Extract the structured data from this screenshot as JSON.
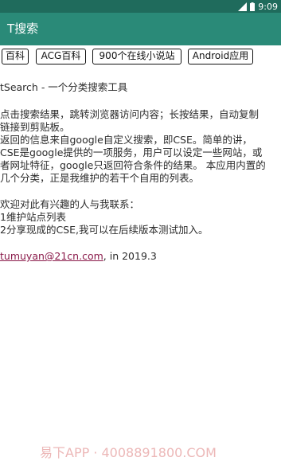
{
  "status_bar": {
    "time": "9:09"
  },
  "app_bar": {
    "title": "T搜索"
  },
  "tabs": [
    "百科",
    "ACG百科",
    "900个在线小说站",
    "Android应用"
  ],
  "content": {
    "app_name_line": "tSearch - 一个分类搜索工具",
    "usage_line_1": "点击搜索结果，跳转浏览器访问内容；长按结果，自动复制",
    "usage_line_2": "链接到剪贴板。",
    "cse_line_1": "返回的信息来自google自定义搜索，即CSE。简单的讲，",
    "cse_line_2": "CSE是google提供的一项服务，用户可以设定一些网站，或",
    "cse_line_3": "者网址特征，google只返回符合条件的结果。 本应用内置的",
    "cse_line_4": "几个分类，正是我维护的若干个自用的列表。",
    "contact_line": "欢迎对此有兴趣的人与我联系：",
    "contact_item_1": "1维护站点列表",
    "contact_item_2": "2分享现成的CSE,我可以在后续版本测试加入。",
    "email": "tumuyan@21cn.com",
    "year_suffix": ", in 2019.3"
  },
  "watermark": "易下APP · 4008891800.COM",
  "colors": {
    "status_bar": "#1f6b5c",
    "app_bar": "#2a8a78",
    "link": "#8a1a4a"
  }
}
